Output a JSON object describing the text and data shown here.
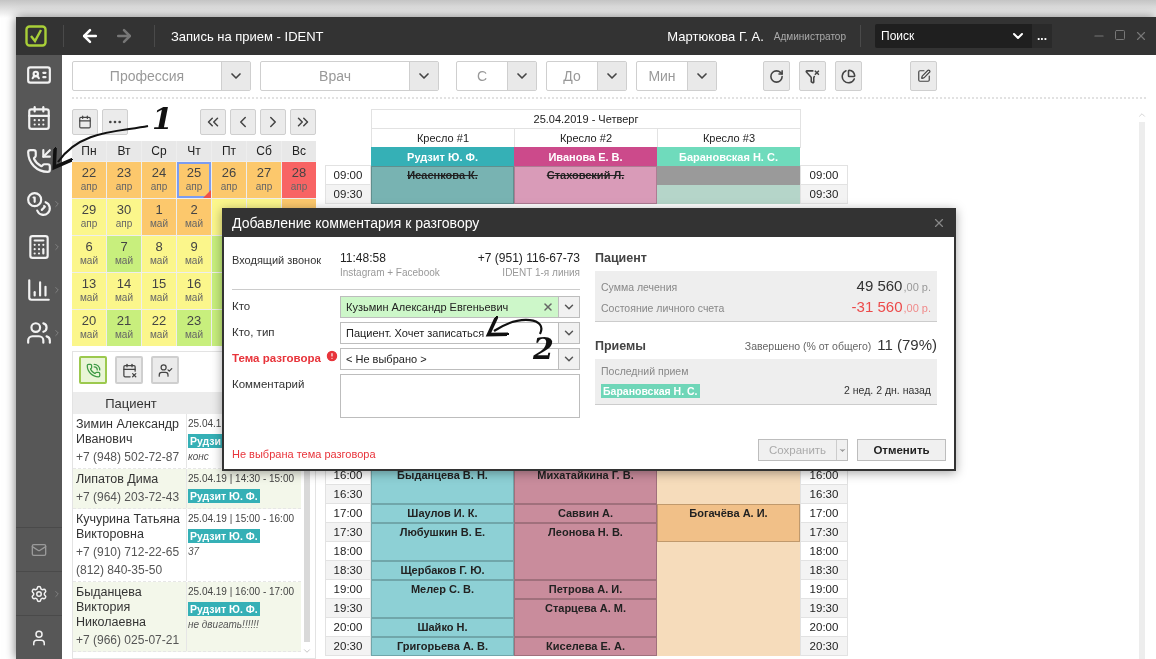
{
  "window": {
    "title": "Запись на прием  - IDENT",
    "back_disabled": false,
    "forward_disabled": true,
    "user": "Мартюкова Г. А.",
    "role": "Администратор",
    "search": {
      "value": "Поиск",
      "more": "..."
    }
  },
  "filters": [
    {
      "placeholder": "Профессия",
      "kind": "wide"
    },
    {
      "placeholder": "Врач",
      "kind": "wide"
    },
    {
      "placeholder": "С",
      "kind": "narrow"
    },
    {
      "placeholder": "До",
      "kind": "narrow"
    },
    {
      "placeholder": "Мин",
      "kind": "narrow"
    }
  ],
  "calendar": {
    "weekdays": [
      "Пн",
      "Вт",
      "Ср",
      "Чт",
      "Пт",
      "Сб",
      "Вс"
    ],
    "weeks": [
      [
        {
          "day": "22",
          "month": "апр",
          "color": "#fcc86c",
          "selected": false,
          "flagged": false
        },
        {
          "day": "23",
          "month": "апр",
          "color": "#fcc86c",
          "selected": false,
          "flagged": false
        },
        {
          "day": "24",
          "month": "апр",
          "color": "#fcc86c",
          "selected": false,
          "flagged": false
        },
        {
          "day": "25",
          "month": "апр",
          "color": "#fcc86c",
          "selected": true,
          "flagged": true
        },
        {
          "day": "26",
          "month": "апр",
          "color": "#fcc86c",
          "selected": false,
          "flagged": false
        },
        {
          "day": "27",
          "month": "апр",
          "color": "#fcc86c",
          "selected": false,
          "flagged": false
        },
        {
          "day": "28",
          "month": "апр",
          "color": "#f86464",
          "selected": false,
          "flagged": false
        }
      ],
      [
        {
          "day": "29",
          "month": "апр",
          "color": "#fbf68b",
          "selected": false,
          "flagged": false
        },
        {
          "day": "30",
          "month": "апр",
          "color": "#fbf68b",
          "selected": false,
          "flagged": false
        },
        {
          "day": "1",
          "month": "май",
          "color": "#fcc86c",
          "selected": false,
          "flagged": false
        },
        {
          "day": "2",
          "month": "май",
          "color": "#fcc86c",
          "selected": false,
          "flagged": false
        },
        {
          "color": "#fbf68b"
        },
        {
          "color": "#fbf68b"
        },
        {
          "color": "#fcc86c"
        }
      ],
      [
        {
          "day": "6",
          "month": "май",
          "color": "#fbf68b",
          "selected": false,
          "flagged": false
        },
        {
          "day": "7",
          "month": "май",
          "color": "#c8ef7d",
          "selected": false,
          "flagged": false
        },
        {
          "day": "8",
          "month": "май",
          "color": "#fbf68b",
          "selected": false,
          "flagged": false
        },
        {
          "day": "9",
          "month": "май",
          "color": "#fbf68b",
          "selected": false,
          "flagged": false
        },
        {
          "color": "#c8ef7d"
        }
      ],
      [
        {
          "day": "13",
          "month": "май",
          "color": "#fbf68b",
          "selected": false,
          "flagged": false
        },
        {
          "day": "14",
          "month": "май",
          "color": "#fbf68b",
          "selected": false,
          "flagged": false
        },
        {
          "day": "15",
          "month": "май",
          "color": "#fbf68b",
          "selected": false,
          "flagged": false
        },
        {
          "day": "16",
          "month": "май",
          "color": "#fbf68b",
          "selected": false,
          "flagged": false
        },
        {
          "color": "#c8ef7d"
        }
      ],
      [
        {
          "day": "20",
          "month": "май",
          "color": "#fbf68b",
          "selected": false,
          "flagged": false
        },
        {
          "day": "21",
          "month": "май",
          "color": "#c8ef7d",
          "selected": false,
          "flagged": false
        },
        {
          "day": "22",
          "month": "май",
          "color": "#fbf68b",
          "selected": false,
          "flagged": false
        },
        {
          "day": "23",
          "month": "май",
          "color": "#c8ef7d",
          "selected": false,
          "flagged": false
        },
        {
          "color": "#c8ef7d"
        }
      ]
    ]
  },
  "call_panel": {
    "tabs": [
      {
        "selected": true
      },
      {
        "selected": false
      },
      {
        "selected": false
      }
    ],
    "column": "Пациент",
    "rows": [
      {
        "name": "Зимин Александр Иванович",
        "phones": [
          "+7 (948) 502-72-87"
        ],
        "time": "25.04.1",
        "doctor": "Рудзи",
        "note": "конс"
      },
      {
        "name": "Липатов Дима",
        "phones": [
          "+7 (964) 203-72-43"
        ],
        "time": "25.04.19 | 14:30 - 15:00",
        "doctor": "Рудзит Ю. Ф."
      },
      {
        "name": "Кучурина Татьяна Викторовна",
        "phones": [
          "+7 (910) 712-22-65",
          "(812) 840-35-50"
        ],
        "time": "25.04.19 | 15:00 - 16:00",
        "doctor": "Рудзит Ю. Ф.",
        "note": "37"
      },
      {
        "name": "Быданцева Виктория Николаевна",
        "phones": [
          "+7 (966) 025-07-21"
        ],
        "time": "25.04.19 | 16:00 - 17:00",
        "doctor": "Рудзит Ю. Ф.",
        "note": "не двигать!!!!!!"
      }
    ]
  },
  "schedule": {
    "date": "25.04.2019 - Четверг",
    "chairs": [
      {
        "name": "Кресло #1",
        "doctor": "Рудзит Ю. Ф.",
        "color": "#35b0b6"
      },
      {
        "name": "Кресло #2",
        "doctor": "Иванова Е. В.",
        "color": "#cc4a8b"
      },
      {
        "name": "Кресло #3",
        "doctor": "Барановская Н. С.",
        "color": "#6fdbbc"
      }
    ],
    "blocks": [
      {
        "rows": [
          {
            "time": "09:00",
            "time_right": "09:00",
            "slots": [
              {
                "kind": "appt",
                "text": "Исаенкова К.",
                "color": "#78b3b2",
                "struck": true
              },
              {
                "kind": "appt",
                "text": "Стаховский Л.",
                "color": "#d99bb8",
                "struck": true
              },
              {
                "kind": "blocked"
              }
            ]
          },
          {
            "time": "09:30",
            "time_right": "09:30",
            "slots": [
              {
                "kind": "cont"
              },
              {
                "kind": "cont"
              },
              {
                "kind": "free",
                "color": "#b5d5c9"
              }
            ]
          }
        ]
      },
      {
        "rows": [
          {
            "time": "16:00",
            "time_right": "16:00",
            "slots": [
              {
                "kind": "appt",
                "text": "Быданцева В. Н.",
                "color": "#8dd0d5",
                "struck": false
              },
              {
                "kind": "appt",
                "text": "Михатайкина Г. В.",
                "color": "#c98c9c",
                "struck": false
              },
              {
                "kind": "free",
                "color": "#f6dcbb"
              }
            ]
          },
          {
            "time": "16:30",
            "time_right": "16:30",
            "slots": [
              {
                "kind": "cont"
              },
              {
                "kind": "cont"
              },
              {
                "kind": "free",
                "color": "#f6dcbb"
              }
            ]
          },
          {
            "time": "17:00",
            "time_right": "17:00",
            "slots": [
              {
                "kind": "appt",
                "text": "Шаулов И. К.",
                "color": "#8dd0d5",
                "struck": false
              },
              {
                "kind": "appt",
                "text": "Саввин А.",
                "color": "#c98c9c",
                "struck": false
              },
              {
                "kind": "appt",
                "text": "Богачёва А. И.",
                "color": "#f1c088",
                "struck": false
              }
            ]
          },
          {
            "time": "17:30",
            "time_right": "17:30",
            "slots": [
              {
                "kind": "appt",
                "text": "Любушкин В. Е.",
                "color": "#8dd0d5",
                "struck": false
              },
              {
                "kind": "appt",
                "text": "Леонова Н. В.",
                "color": "#c98c9c",
                "struck": false
              },
              {
                "kind": "cont"
              }
            ]
          },
          {
            "time": "18:00",
            "time_right": "18:00",
            "slots": [
              {
                "kind": "cont"
              },
              {
                "kind": "cont"
              },
              {
                "kind": "free",
                "color": "#f6dcbb"
              }
            ]
          },
          {
            "time": "18:30",
            "time_right": "18:30",
            "slots": [
              {
                "kind": "appt",
                "text": "Щербаков Г. Ю.",
                "color": "#8dd0d5",
                "struck": false
              },
              {
                "kind": "cont"
              },
              {
                "kind": "free",
                "color": "#f6dcbb"
              }
            ]
          },
          {
            "time": "19:00",
            "time_right": "19:00",
            "slots": [
              {
                "kind": "appt",
                "text": "Мелер С. В.",
                "color": "#8dd0d5",
                "struck": false
              },
              {
                "kind": "appt",
                "text": "Петрова А. И.",
                "color": "#c98c9c",
                "struck": false
              },
              {
                "kind": "free",
                "color": "#f6dcbb"
              }
            ]
          },
          {
            "time": "19:30",
            "time_right": "19:30",
            "slots": [
              {
                "kind": "cont"
              },
              {
                "kind": "appt",
                "text": "Старцева А. М.",
                "color": "#c98c9c",
                "struck": false
              },
              {
                "kind": "free",
                "color": "#f6dcbb"
              }
            ]
          },
          {
            "time": "20:00",
            "time_right": "20:00",
            "slots": [
              {
                "kind": "appt",
                "text": "Шайко Н.",
                "color": "#8dd0d5",
                "struck": false
              },
              {
                "kind": "cont"
              },
              {
                "kind": "free",
                "color": "#f6dcbb"
              }
            ]
          },
          {
            "time": "20:30",
            "time_right": "20:30",
            "slots": [
              {
                "kind": "appt",
                "text": "Григорьева А. В.",
                "color": "#8dd0d5",
                "struck": false
              },
              {
                "kind": "appt",
                "text": "Киселева Е. А.",
                "color": "#c98c9c",
                "struck": false
              },
              {
                "kind": "free",
                "color": "#f6dcbb"
              }
            ]
          }
        ]
      }
    ]
  },
  "dialog": {
    "title": "Добавление комментария к разговору",
    "call": {
      "label": "Входящий звонок",
      "time": "11:48:58",
      "source": "Instagram + Facebook",
      "phone": "+7 (951) 116-67-73",
      "line": "IDENT 1-я линия"
    },
    "fields": [
      {
        "label": "Кто",
        "kind": "combo",
        "value": "Кузьмин Александр Евгеньевич",
        "matched": true,
        "clearable": true,
        "error": false
      },
      {
        "label": "Кто, тип",
        "kind": "combo",
        "value": "Пациент. Хочет записаться",
        "matched": false,
        "clearable": false,
        "error": false
      },
      {
        "label": "Тема разговора",
        "kind": "combo",
        "value": "< Не выбрано >",
        "matched": false,
        "clearable": false,
        "error": true
      },
      {
        "label": "Комментарий",
        "kind": "textarea",
        "error": false
      }
    ],
    "error_message": "Не выбрана тема разговора",
    "patient": {
      "title": "Пациент",
      "lines": [
        {
          "label": "Сумма лечения",
          "amount": "49 560",
          "cents": ",00 р.",
          "negative": false
        },
        {
          "label": "Состояние личного счета",
          "amount": "-31 560",
          "cents": ",00 р.",
          "negative": true
        }
      ]
    },
    "visits": {
      "title": "Приемы",
      "completed_label": "Завершено (% от общего)",
      "completed": "11 (79%)",
      "last_label": "Последний прием",
      "last": {
        "doctor": "Барановская Н. С.",
        "color": "#6fd6b8",
        "ago": "2 нед. 2 дн. назад"
      }
    },
    "buttons": [
      {
        "label": "Сохранить",
        "disabled": true,
        "split": true
      },
      {
        "label": "Отменить",
        "disabled": false,
        "split": false
      }
    ]
  },
  "annotations": [
    {
      "label": "1"
    },
    {
      "label": "2"
    }
  ]
}
